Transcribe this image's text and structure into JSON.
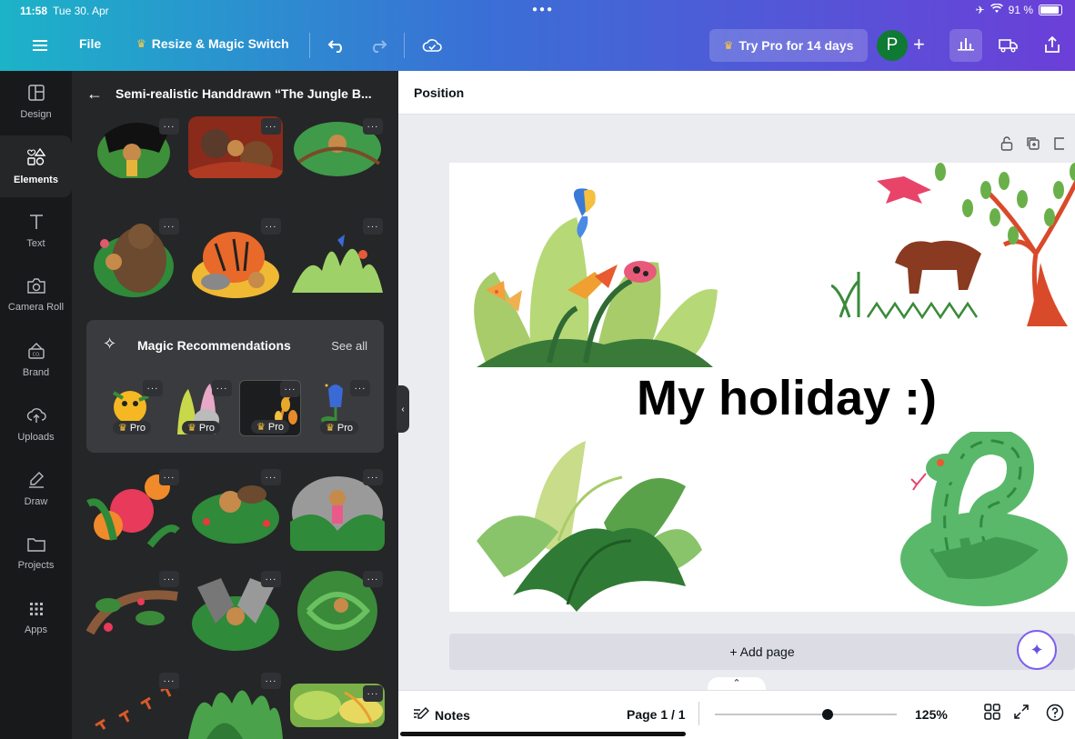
{
  "status": {
    "time": "11:58",
    "date": "Tue 30. Apr",
    "battery": "91 %"
  },
  "toolbar": {
    "file_label": "File",
    "resize_label": "Resize & Magic Switch",
    "try_pro_label": "Try Pro for 14 days",
    "avatar_initial": "P",
    "plus_label": "+"
  },
  "rail": {
    "items": [
      {
        "label": "Design"
      },
      {
        "label": "Elements"
      },
      {
        "label": "Text"
      },
      {
        "label": "Camera Roll"
      },
      {
        "label": "Brand"
      },
      {
        "label": "Uploads"
      },
      {
        "label": "Draw"
      },
      {
        "label": "Projects"
      },
      {
        "label": "Apps"
      }
    ],
    "active": "Elements"
  },
  "panel": {
    "title": "Semi-realistic Handdrawn “The Jungle B...",
    "more_label": "···",
    "magic": {
      "title": "Magic Recommendations",
      "see_all": "See all",
      "pro_label": "Pro"
    }
  },
  "canvas": {
    "position_label": "Position",
    "page_title": "My holiday :)",
    "add_page_label": "+ Add page"
  },
  "bottom": {
    "notes_label": "Notes",
    "page_label": "Page 1 / 1",
    "zoom_label": "125%",
    "zoom_level": 0.62
  },
  "colors": {
    "accent": "#7b5cf0",
    "rail_bg": "#18191b",
    "panel_bg": "#252627",
    "avatar_bg": "#0e7a33"
  }
}
